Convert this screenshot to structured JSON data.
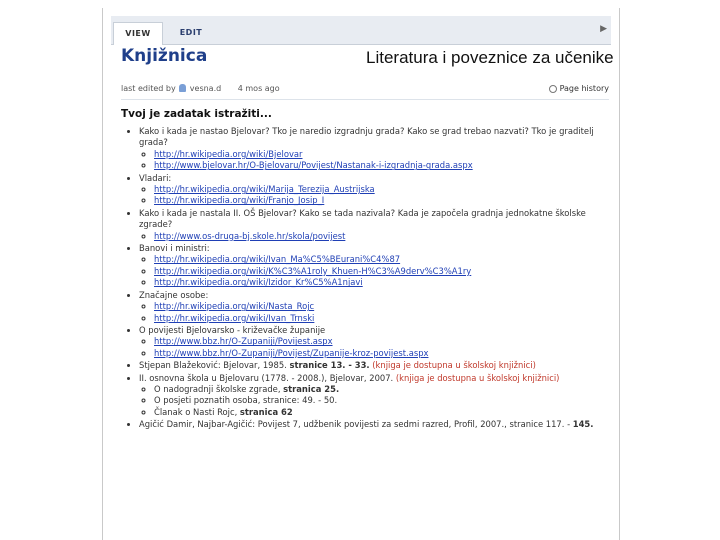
{
  "tabs": {
    "view": "VIEW",
    "edit": "EDIT"
  },
  "header": {
    "page_title": "Knjižnica",
    "doc_title": "Literatura i poveznice za učenike"
  },
  "meta": {
    "edited_by": "last edited by",
    "user": "vesna.d",
    "ago": "4 mos ago",
    "page_history": "Page history"
  },
  "section_heading": "Tvoj je zadatak istražiti...",
  "items": {
    "q1": "Kako i kada je nastao Bjelovar? Tko je naredio izgradnju grada? Kako se grad trebao nazvati? Tko je graditelj grada?",
    "q1_links": [
      "http://hr.wikipedia.org/wiki/Bjelovar",
      "http://www.bjelovar.hr/O-Bjelovaru/Povijest/Nastanak-i-izgradnja-grada.aspx"
    ],
    "q2": "Vladari:",
    "q2_links": [
      "http://hr.wikipedia.org/wiki/Marija_Terezija_Austrijska",
      "http://hr.wikipedia.org/wiki/Franjo_Josip_I"
    ],
    "q3": "Kako i kada je nastala II. OŠ Bjelovar? Kako se tada nazivala? Kada je započela gradnja jednokatne školske zgrade?",
    "q3_links": [
      "http://www.os-druga-bj.skole.hr/skola/povijest"
    ],
    "q4": "Banovi i ministri:",
    "q4_links": [
      "http://hr.wikipedia.org/wiki/Ivan_Ma%C5%BEurani%C4%87",
      "http://hr.wikipedia.org/wiki/K%C3%A1roly_Khuen-H%C3%A9derv%C3%A1ry",
      "http://hr.wikipedia.org/wiki/Izidor_Kr%C5%A1njavi"
    ],
    "q5": "Značajne osobe:",
    "q5_links": [
      "http://hr.wikipedia.org/wiki/Nasta_Rojc",
      "http://hr.wikipedia.org/wiki/Ivan_Trnski"
    ],
    "q6": "O povijesti Bjelovarsko - križevačke županije",
    "q6_links": [
      "http://www.bbz.hr/O-Zupaniji/Povijest.aspx",
      "http://www.bbz.hr/O-Zupaniji/Povijest/Zupanije-kroz-povijest.aspx"
    ],
    "b1_text": "Stjepan Blažeković: Bjelovar, 1985. ",
    "b1_pages": "stranice 13. - 33.",
    "b1_note": " (knjiga je dostupna u školskoj knjižnici)",
    "b2_text": "II. osnovna škola u Bjelovaru (1778. - 2008.), Bjelovar, 2007. ",
    "b2_note": "(knjiga je dostupna u školskoj knjižnici)",
    "b2_sub1_text": "O nadogradnji školske zgrade, ",
    "b2_sub1_pages": "stranica 25.",
    "b2_sub2": "O posjeti poznatih osoba, stranice: 49. - 50.",
    "b2_sub3_text": "Članak o Nasti Rojc, ",
    "b2_sub3_pages": "stranica 62",
    "b3_text": "Agičić Damir, Najbar-Agičić: Povijest 7, udžbenik povijesti za sedmi razred, Profil, 2007., stranice 117. - ",
    "b3_pages": "145."
  }
}
